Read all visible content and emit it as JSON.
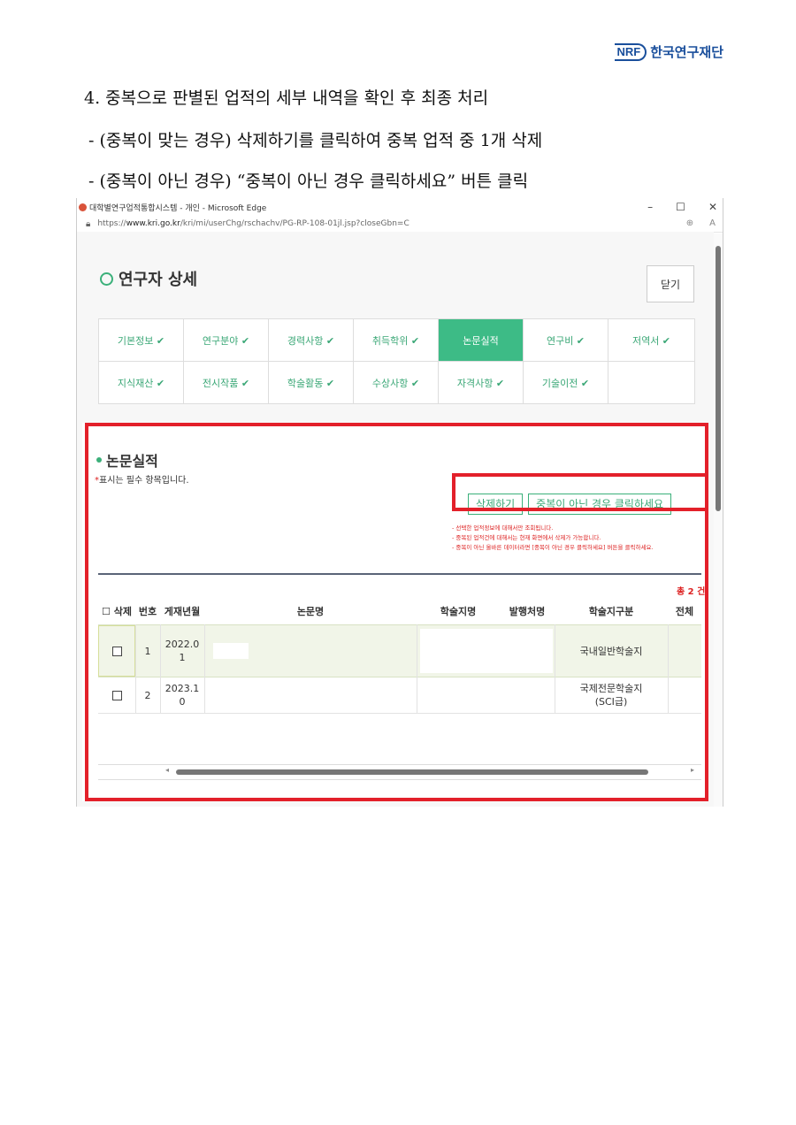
{
  "logo": {
    "mark": "NRF",
    "name": "한국연구재단"
  },
  "instructions": [
    "4. 중복으로 판별된 업적의 세부 내역을 확인 후 최종 처리",
    "- (중복이 맞는 경우) 삭제하기를 클릭하여 중복 업적 중 1개 삭제",
    "- (중복이 아닌 경우) “중복이 아닌 경우 클릭하세요” 버튼 클릭"
  ],
  "window": {
    "title": "대학별연구업적통합시스템 - 개인 - Microsoft Edge",
    "controls": {
      "minimize": "–",
      "maximize": "☐",
      "close": "✕"
    },
    "url_prefix": "https://",
    "url_host": "www.kri.go.kr",
    "url_path": "/kri/mi/userChg/rschachv/PG-RP-108-01jl.jsp?closeGbn=C"
  },
  "page": {
    "title": "연구자 상세",
    "close_label": "닫기"
  },
  "tabs": [
    {
      "label": "기본정보 ✔",
      "active": false
    },
    {
      "label": "연구분야 ✔",
      "active": false
    },
    {
      "label": "경력사항 ✔",
      "active": false
    },
    {
      "label": "취득학위 ✔",
      "active": false
    },
    {
      "label": "논문실적",
      "active": true
    },
    {
      "label": "연구비 ✔",
      "active": false
    },
    {
      "label": "저역서 ✔",
      "active": false
    },
    {
      "label": "지식재산 ✔",
      "active": false
    },
    {
      "label": "전시작품 ✔",
      "active": false
    },
    {
      "label": "학술활동 ✔",
      "active": false
    },
    {
      "label": "수상사항 ✔",
      "active": false
    },
    {
      "label": "자격사항 ✔",
      "active": false
    },
    {
      "label": "기술이전 ✔",
      "active": false
    }
  ],
  "section": {
    "title": "논문실적",
    "required_star": "*",
    "required_text": "표시는 필수 항목입니다.",
    "delete_button": "삭제하기",
    "not_duplicate_button": "중복이 아닌 경우 클릭하세요",
    "notes": [
      "- 선택한 업적정보에 대해서만 조회됩니다.",
      "- 중복된 업적건에 대해서는 현재 화면에서 삭제가 가능합니다.",
      "- 중복이 아닌 올바른 데이터라면 [중복이 아닌 경우 클릭하세요] 버튼을 클릭하세요."
    ],
    "total": "총 2 건"
  },
  "table": {
    "headers": [
      "☐ 삭제",
      "번호",
      "게재년월",
      "논문명",
      "학술지명",
      "발행처명",
      "학술지구분",
      "전체"
    ],
    "rows": [
      {
        "no": "1",
        "date": "2022.0\n1",
        "title": "",
        "journal": "",
        "publisher": "",
        "category": "국내일반학술지"
      },
      {
        "no": "2",
        "date": "2023.1\n0",
        "title": "",
        "journal": "",
        "publisher": "",
        "category": "국제전문학술지\n(SCI급)"
      }
    ]
  },
  "colors": {
    "accent": "#3dbb86",
    "highlight": "#e3202a"
  }
}
